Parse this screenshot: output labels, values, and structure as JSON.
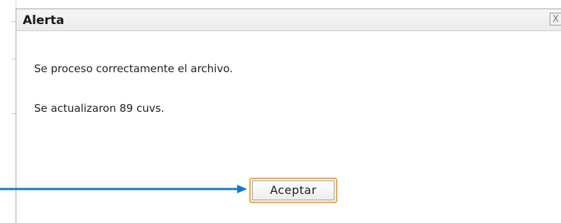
{
  "dialog": {
    "title": "Alerta",
    "close_glyph": "X",
    "messages": [
      "Se proceso correctamente el archivo.",
      "Se actualizaron 89 cuvs."
    ],
    "accept_label": "Aceptar"
  },
  "annotation": {
    "arrow_color": "#1478c8"
  }
}
